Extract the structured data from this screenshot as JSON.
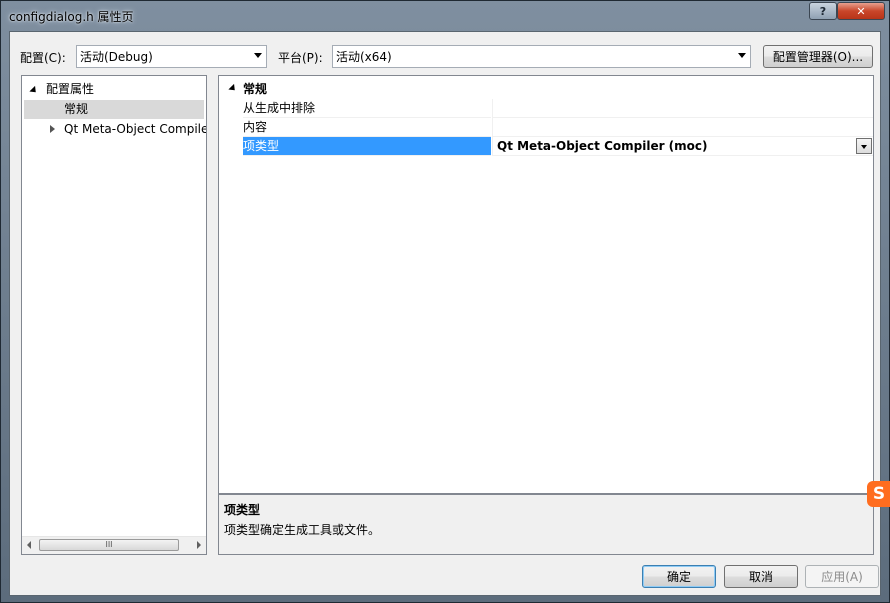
{
  "window": {
    "title": "configdialog.h 属性页",
    "help_label": "?",
    "close_label": "✕"
  },
  "toolbar": {
    "config_label": "配置(C):",
    "config_value": "活动(Debug)",
    "platform_label": "平台(P):",
    "platform_value": "活动(x64)",
    "config_manager_label": "配置管理器(O)..."
  },
  "tree": {
    "root_label": "配置属性",
    "items": [
      {
        "label": "常规",
        "selected": true
      },
      {
        "label": "Qt Meta-Object Compiler",
        "selected": false
      }
    ],
    "scroll_thumb_grip": "III"
  },
  "grid": {
    "category": "常规",
    "rows": [
      {
        "name": "从生成中排除",
        "value": ""
      },
      {
        "name": "内容",
        "value": ""
      },
      {
        "name": "项类型",
        "value": "Qt Meta-Object Compiler (moc)"
      }
    ]
  },
  "description": {
    "title": "项类型",
    "text": "项类型确定生成工具或文件。"
  },
  "buttons": {
    "ok": "确定",
    "cancel": "取消",
    "apply": "应用(A)"
  },
  "overlay": {
    "ime_badge": "S"
  }
}
